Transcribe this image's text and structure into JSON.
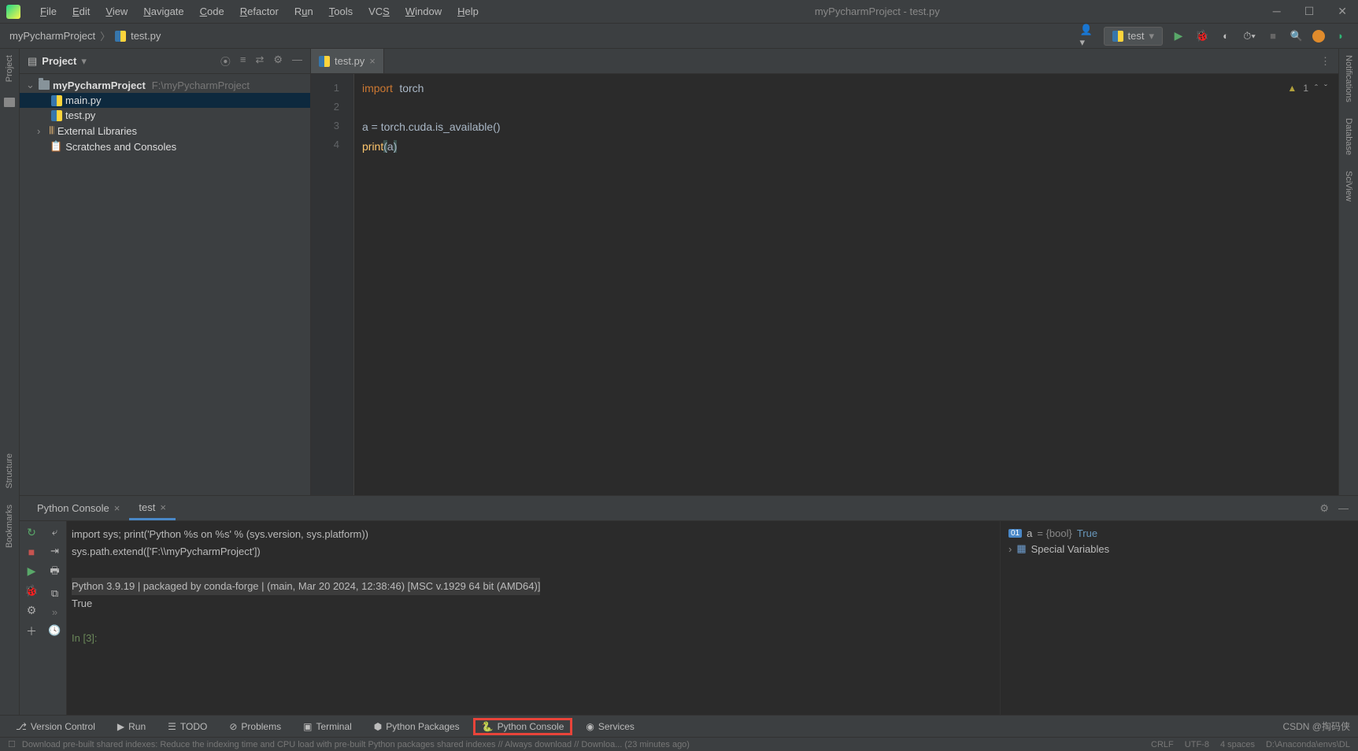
{
  "window": {
    "title": "myPycharmProject - test.py"
  },
  "menu": [
    "File",
    "Edit",
    "View",
    "Navigate",
    "Code",
    "Refactor",
    "Run",
    "Tools",
    "VCS",
    "Window",
    "Help"
  ],
  "breadcrumb": {
    "project": "myPycharmProject",
    "file": "test.py"
  },
  "run_config": "test",
  "sidebar": {
    "title": "Project",
    "tree": {
      "root": {
        "name": "myPycharmProject",
        "path": "F:\\myPycharmProject"
      },
      "files": [
        "main.py",
        "test.py"
      ],
      "ext_lib": "External Libraries",
      "scratches": "Scratches and Consoles"
    }
  },
  "editor": {
    "tab": "test.py",
    "problems": "1",
    "lines": [
      "1",
      "2",
      "3",
      "4"
    ],
    "code_tokens": {
      "l1a": "import",
      "l1b": "torch",
      "l3": "a = torch.cuda.is_available()",
      "l4a": "print",
      "l4b": "(",
      "l4c": "a",
      "l4d": ")"
    }
  },
  "console": {
    "tabs": {
      "a": "Python Console",
      "b": "test"
    },
    "line1": "import sys; print('Python %s on %s' % (sys.version, sys.platform))",
    "line2": "sys.path.extend(['F:\\\\myPycharmProject'])",
    "line3": "Python 3.9.19 | packaged by conda-forge | (main, Mar 20 2024, 12:38:46) [MSC v.1929 64 bit (AMD64)]",
    "line4": "True",
    "prompt": "In [3]:"
  },
  "vars": {
    "a_name": "a",
    "a_type": "= {bool}",
    "a_val": "True",
    "special": "Special Variables"
  },
  "bottom_tools": {
    "vcs": "Version Control",
    "run": "Run",
    "todo": "TODO",
    "problems": "Problems",
    "terminal": "Terminal",
    "pkg": "Python Packages",
    "console": "Python Console",
    "services": "Services"
  },
  "status": {
    "left": "Download pre-built shared indexes: Reduce the indexing time and CPU load with pre-built Python packages shared indexes // Always download // Downloa... (23 minutes ago)",
    "crlf": "CRLF",
    "enc": "UTF-8",
    "indent": "4 spaces",
    "interp": "D:\\Anaconda\\envs\\DL"
  },
  "watermark": "CSDN @掏码侠",
  "right_labels": {
    "notif": "Notifications",
    "db": "Database",
    "sci": "SciView"
  },
  "left_labels": {
    "project": "Project",
    "structure": "Structure",
    "bookmarks": "Bookmarks"
  }
}
